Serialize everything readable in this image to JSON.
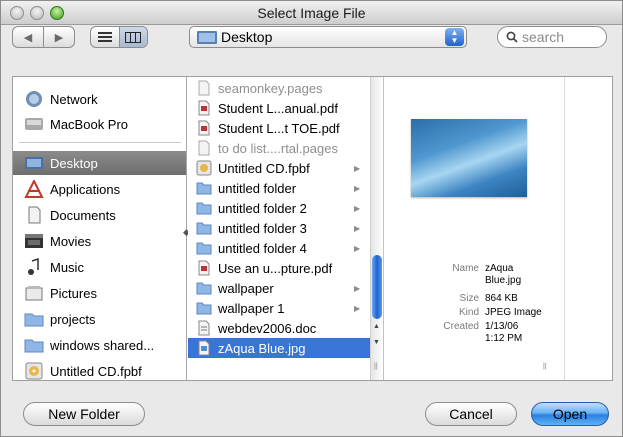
{
  "window": {
    "title": "Select Image File"
  },
  "toolbar": {
    "location": "Desktop",
    "search_placeholder": "search"
  },
  "sidebar": {
    "items": [
      {
        "label": "Network",
        "icon": "network-icon"
      },
      {
        "label": "MacBook Pro",
        "icon": "hard-drive-icon"
      },
      {
        "label": "Desktop",
        "icon": "desktop-icon",
        "selected": true
      },
      {
        "label": "Applications",
        "icon": "applications-icon"
      },
      {
        "label": "Documents",
        "icon": "documents-icon"
      },
      {
        "label": "Movies",
        "icon": "movies-icon"
      },
      {
        "label": "Music",
        "icon": "music-icon"
      },
      {
        "label": "Pictures",
        "icon": "pictures-icon"
      },
      {
        "label": "projects",
        "icon": "folder-icon"
      },
      {
        "label": "windows shared...",
        "icon": "folder-icon"
      },
      {
        "label": "Untitled CD.fpbf",
        "icon": "cd-icon"
      }
    ]
  },
  "files": [
    {
      "name": "seamonkey.pages",
      "dim": true,
      "folder": false
    },
    {
      "name": "Student L...anual.pdf",
      "dim": false,
      "folder": false
    },
    {
      "name": "Student L...t TOE.pdf",
      "dim": false,
      "folder": false
    },
    {
      "name": "to do list....rtal.pages",
      "dim": true,
      "folder": false
    },
    {
      "name": "Untitled CD.fpbf",
      "dim": false,
      "folder": true
    },
    {
      "name": "untitled folder",
      "dim": false,
      "folder": true
    },
    {
      "name": "untitled folder 2",
      "dim": false,
      "folder": true
    },
    {
      "name": "untitled folder 3",
      "dim": false,
      "folder": true
    },
    {
      "name": "untitled folder 4",
      "dim": false,
      "folder": true
    },
    {
      "name": "Use an u...pture.pdf",
      "dim": false,
      "folder": false
    },
    {
      "name": "wallpaper",
      "dim": false,
      "folder": true
    },
    {
      "name": "wallpaper 1",
      "dim": false,
      "folder": true
    },
    {
      "name": "webdev2006.doc",
      "dim": false,
      "folder": false
    },
    {
      "name": "zAqua Blue.jpg",
      "dim": false,
      "folder": false,
      "selected": true
    }
  ],
  "preview": {
    "name_label": "Name",
    "name_value_1": "zAqua",
    "name_value_2": "Blue.jpg",
    "size_label": "Size",
    "size_value": "864 KB",
    "kind_label": "Kind",
    "kind_value": "JPEG Image",
    "created_label": "Created",
    "created_value_1": "1/13/06",
    "created_value_2": "1:12 PM"
  },
  "buttons": {
    "new_folder": "New Folder",
    "cancel": "Cancel",
    "open": "Open"
  },
  "colors": {
    "selection": "#3875d7",
    "sidebar_selection": "#7d7d7d",
    "primary_button": "#2a7fe0"
  }
}
